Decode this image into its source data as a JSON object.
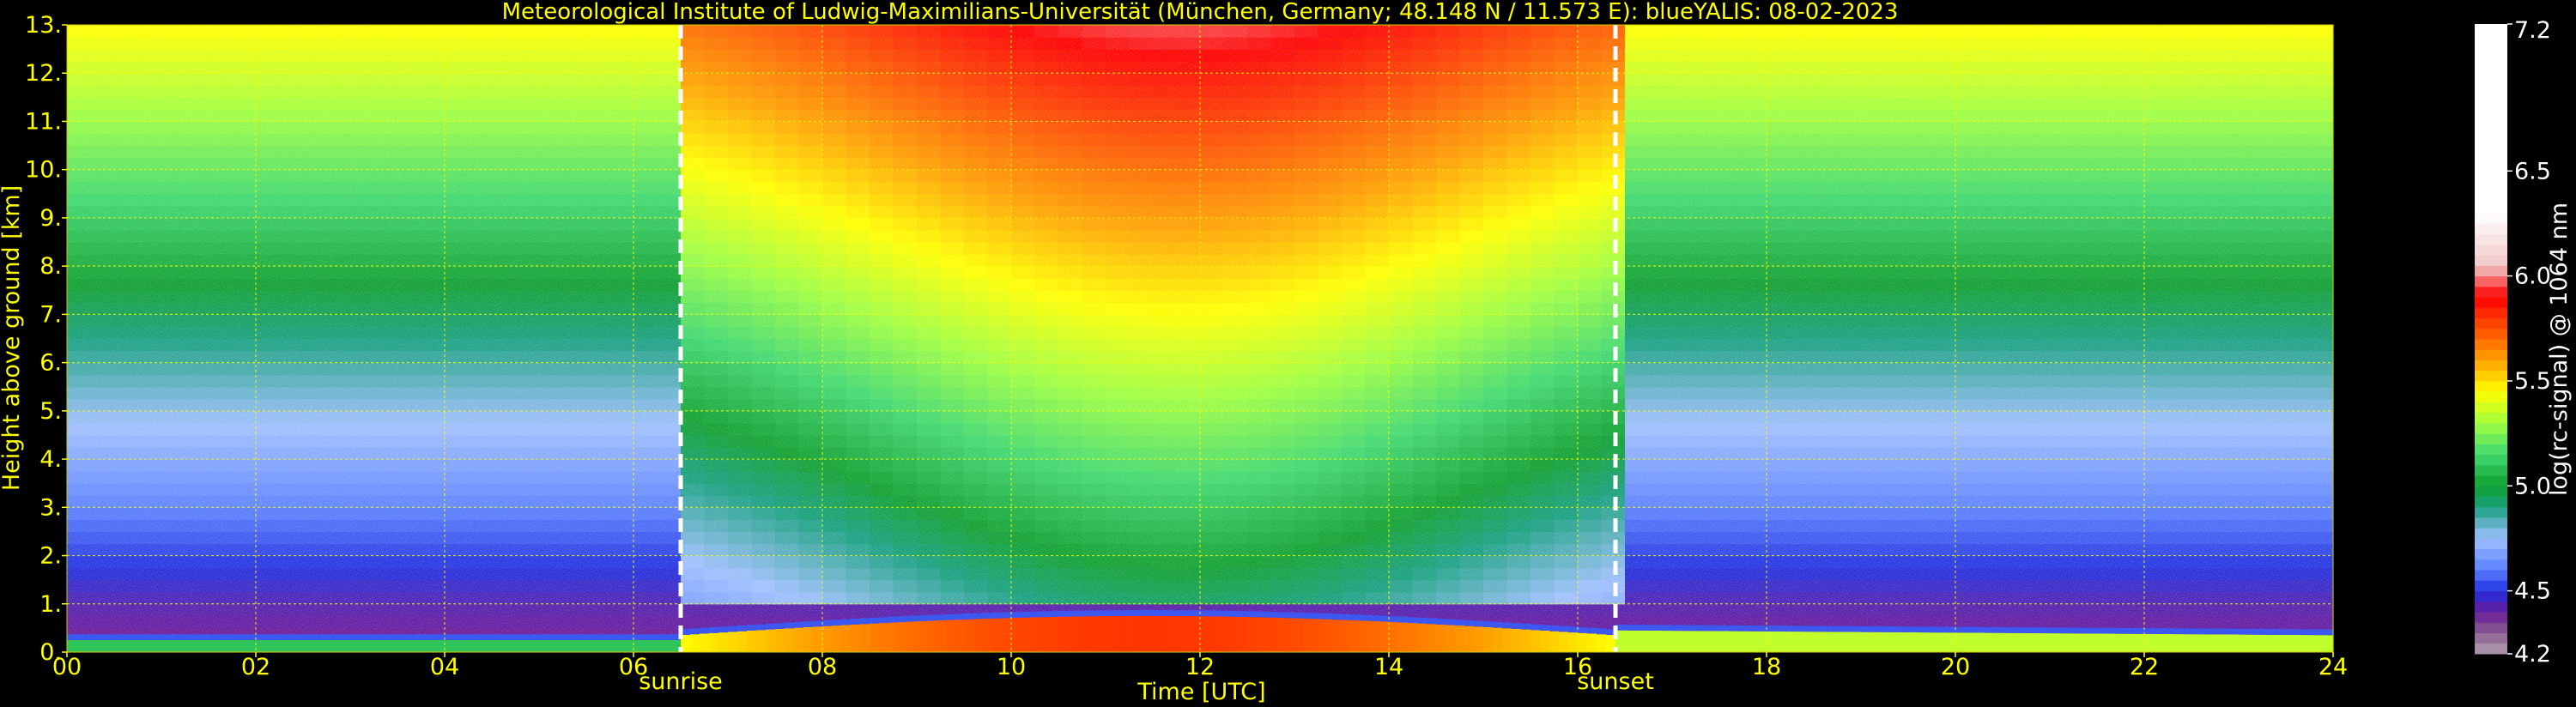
{
  "chart_data": {
    "type": "heatmap",
    "title": "Meteorological Institute of Ludwig-Maximilians-Universität (München, Germany; 48.148 N / 11.573 E):     blueYALIS: 08-02-2023",
    "xlabel": "Time [UTC]",
    "ylabel": "Height above ground [km]",
    "xlim": [
      0,
      24
    ],
    "ylim": [
      0,
      13
    ],
    "x_ticks": [
      "00",
      "02",
      "04",
      "06",
      "08",
      "10",
      "12",
      "14",
      "16",
      "18",
      "20",
      "22",
      "24"
    ],
    "y_ticks": [
      "0.",
      "1.",
      "2.",
      "3.",
      "4.",
      "5.",
      "6.",
      "7.",
      "8.",
      "9.",
      "10.",
      "11.",
      "12.",
      "13."
    ],
    "grid": true,
    "events": [
      {
        "label": "sunrise",
        "time": 6.5
      },
      {
        "label": "sunset",
        "time": 16.4
      }
    ],
    "colorbar": {
      "label": "log(rc-signal) @ 1064 nm",
      "min": 4.2,
      "max": 7.2,
      "tick_labels": [
        "4.2",
        "4.5",
        "5.0",
        "5.5",
        "6.0",
        "6.5",
        "7.2"
      ],
      "tick_values": [
        4.2,
        4.5,
        5.0,
        5.5,
        6.0,
        6.5,
        7.2
      ]
    },
    "colors": {
      "background": "#000000",
      "text": "#ffff00",
      "grid": "#ffff00",
      "colorbar_label": "#ffffff",
      "event_line": "#ffffff"
    }
  }
}
